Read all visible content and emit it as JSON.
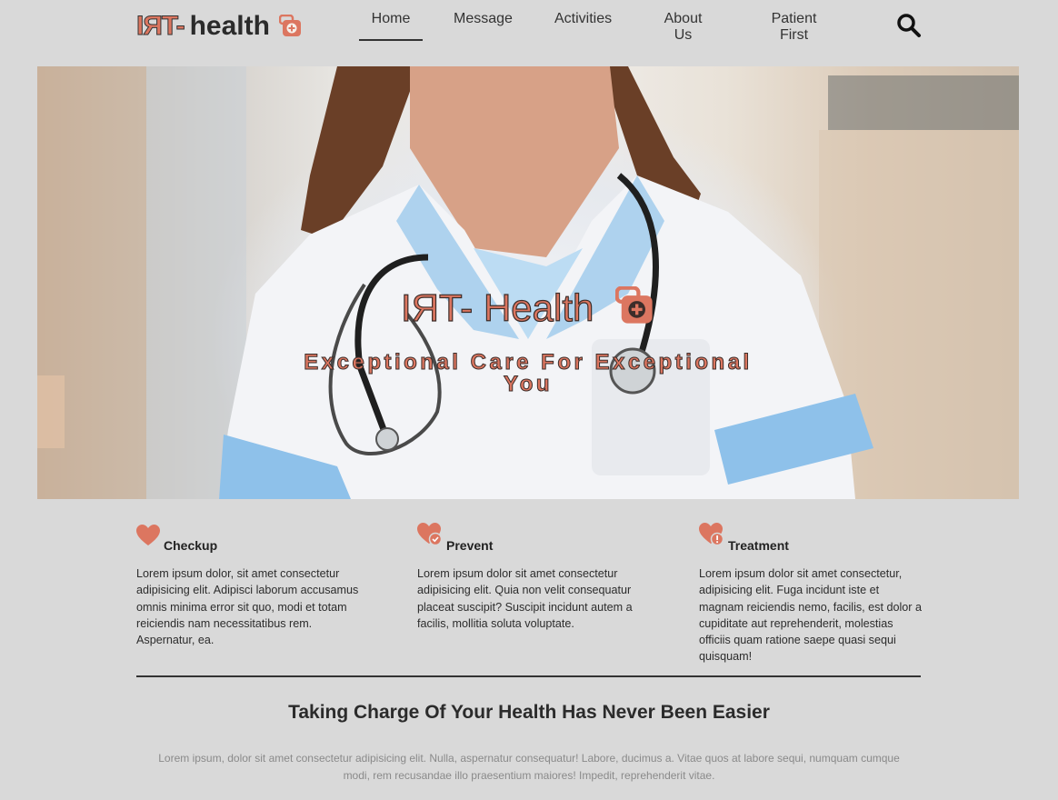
{
  "header": {
    "logo_mark": "IЯT-",
    "logo_text": "health",
    "logo_icon": "medical-bag-icon",
    "nav": [
      {
        "label": "Home",
        "active": true
      },
      {
        "label": "Message",
        "active": false
      },
      {
        "label": "Activities",
        "active": false
      },
      {
        "label": "About Us",
        "active": false
      },
      {
        "label": "Patient First",
        "active": false
      }
    ],
    "search_icon": "search-icon"
  },
  "hero": {
    "title": "IЯT- Health",
    "subtitle": "Exceptional Care For Exceptional You",
    "image": "doctor-with-stethoscope-photo"
  },
  "features": [
    {
      "icon": "heart-icon",
      "title": "Checkup",
      "body": "Lorem ipsum dolor, sit amet consectetur adipisicing elit. Adipisci laborum accusamus omnis minima error sit quo, modi et totam reiciendis nam necessitatibus rem. Aspernatur, ea."
    },
    {
      "icon": "heart-check-icon",
      "title": "Prevent",
      "body": "Lorem ipsum dolor sit amet consectetur adipisicing elit. Quia non velit consequatur placeat suscipit? Suscipit incidunt autem a facilis, mollitia soluta voluptate."
    },
    {
      "icon": "heart-alert-icon",
      "title": "Treatment",
      "body": "Lorem ipsum dolor sit amet consectetur, adipisicing elit. Fuga incidunt iste et magnam reiciendis nemo, facilis, est dolor a cupiditate aut reprehenderit, molestias officiis quam ratione saepe quasi sequi quisquam!"
    }
  ],
  "section": {
    "title": "Taking Charge Of Your Health Has Never Been Easier",
    "body": "Lorem ipsum, dolor sit amet consectetur adipisicing elit. Nulla, aspernatur consequatur! Labore, ducimus a. Vitae quos at labore sequi, numquam cumque modi, rem recusandae illo praesentium maiores! Impedit, reprehenderit vitae."
  },
  "colors": {
    "accent": "#dc7660",
    "background": "#d9d9d9",
    "text": "#222222"
  }
}
